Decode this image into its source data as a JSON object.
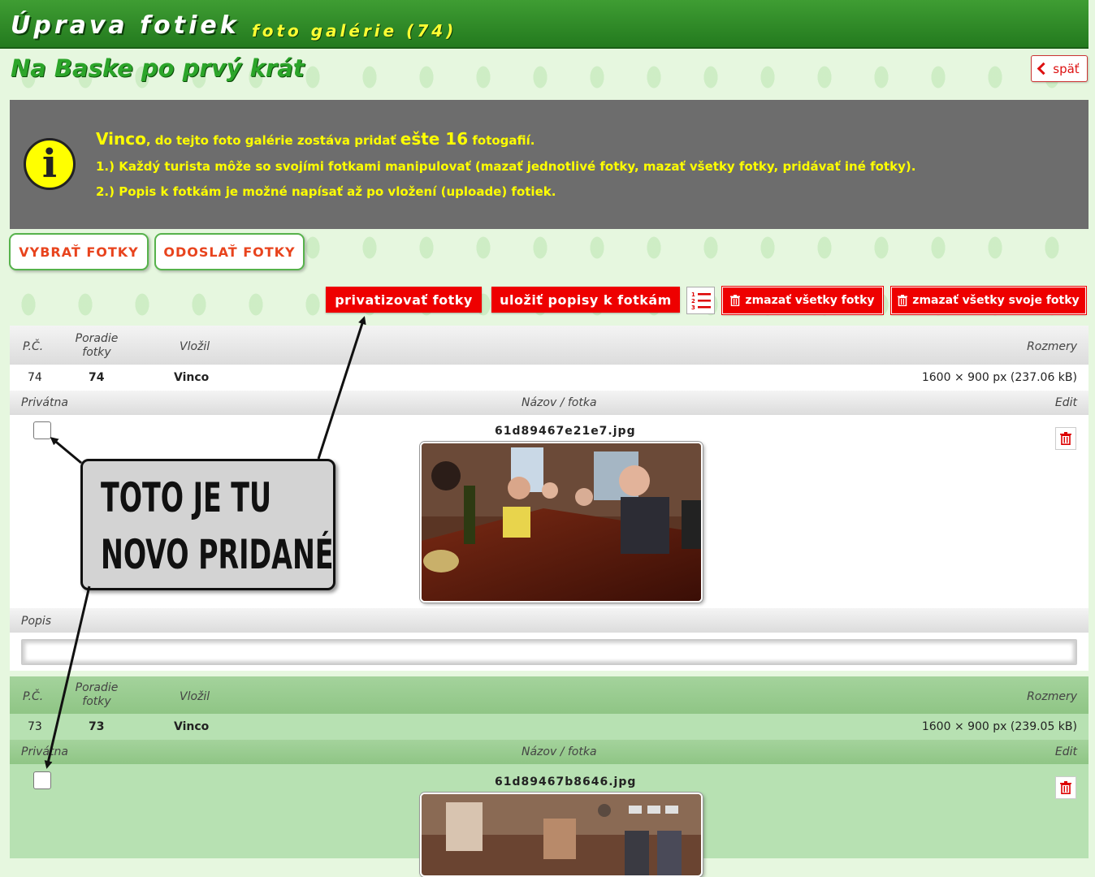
{
  "header": {
    "title": "Úprava fotiek",
    "subtitle": "foto galérie (74)"
  },
  "gallery": {
    "name": "Na Baske po prvý krát"
  },
  "back_button": {
    "label": "späť"
  },
  "info": {
    "icon": "info-icon",
    "user": "Vinco",
    "line1_mid": ", do tejto foto galérie zostáva pridať ",
    "remaining": "ešte 16",
    "line1_end": " fotogafií.",
    "line2": "1.) Každý turista môže so svojími fotkami manipulovať (mazať jednotlivé fotky, mazať všetky fotky, pridávať iné fotky).",
    "line3": "2.) Popis k fotkám je možné napísať až po vložení (uploade) fotiek."
  },
  "buttons": {
    "select": "VYBRAŤ FOTKY",
    "send": "ODOSLAŤ FOTKY",
    "privatize": "privatizovať fotky",
    "save_desc": "uložiť popisy k fotkám",
    "delete_all": "zmazať všetky fotky",
    "delete_own": "zmazať všetky svoje fotky"
  },
  "columns": {
    "pc": "P.Č.",
    "order_l1": "Poradie",
    "order_l2": "fotky",
    "author": "Vložil",
    "size": "Rozmery",
    "private": "Privátna",
    "name": "Názov / fotka",
    "edit": "Edit",
    "desc": "Popis"
  },
  "photos": [
    {
      "pc": "74",
      "order": "74",
      "author": "Vinco",
      "size": "1600 × 900 px (237.06 kB)",
      "filename": "61d89467e21e7.jpg",
      "private": false,
      "description": ""
    },
    {
      "pc": "73",
      "order": "73",
      "author": "Vinco",
      "size": "1600 × 900 px (239.05 kB)",
      "filename": "61d89467b8646.jpg",
      "private": false,
      "description": ""
    }
  ],
  "annotation": {
    "line1": "TOTO JE TU",
    "line2": "NOVO PRIDANÉ"
  }
}
